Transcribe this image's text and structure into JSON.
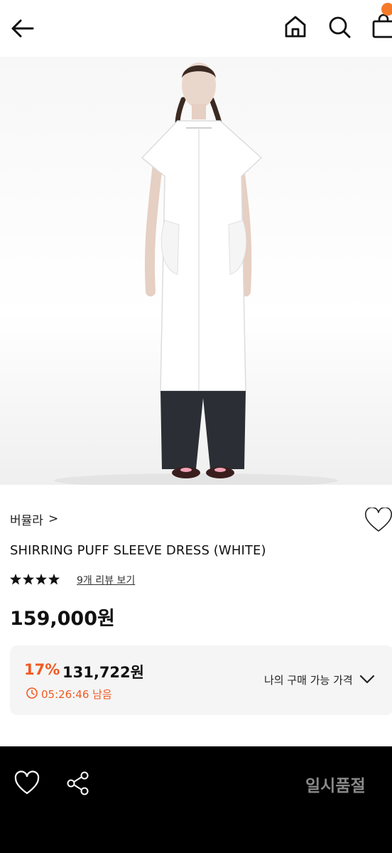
{
  "header": {
    "back_icon": "arrow-left-icon",
    "home_icon": "home-icon",
    "search_icon": "search-icon",
    "cart_icon": "shopping-bag-icon",
    "badge_color": "#f47a2a"
  },
  "product": {
    "brand": "버뮬라",
    "brand_chevron": ">",
    "title": "SHIRRING PUFF SLEEVE DRESS (WHITE)",
    "rating": 4.5,
    "rating_max": 5,
    "review_link": "9개 리뷰 보기",
    "price": "159,000원"
  },
  "coupon": {
    "discount": "17%",
    "discount_price": "131,722원",
    "timer": "05:26:46 남음",
    "my_price_label": "나의 구매 가능 가격",
    "accent": "#f05a22"
  },
  "bottom": {
    "wishlist_icon": "heart-outline-icon",
    "share_icon": "share-icon",
    "status": "일시품절"
  }
}
